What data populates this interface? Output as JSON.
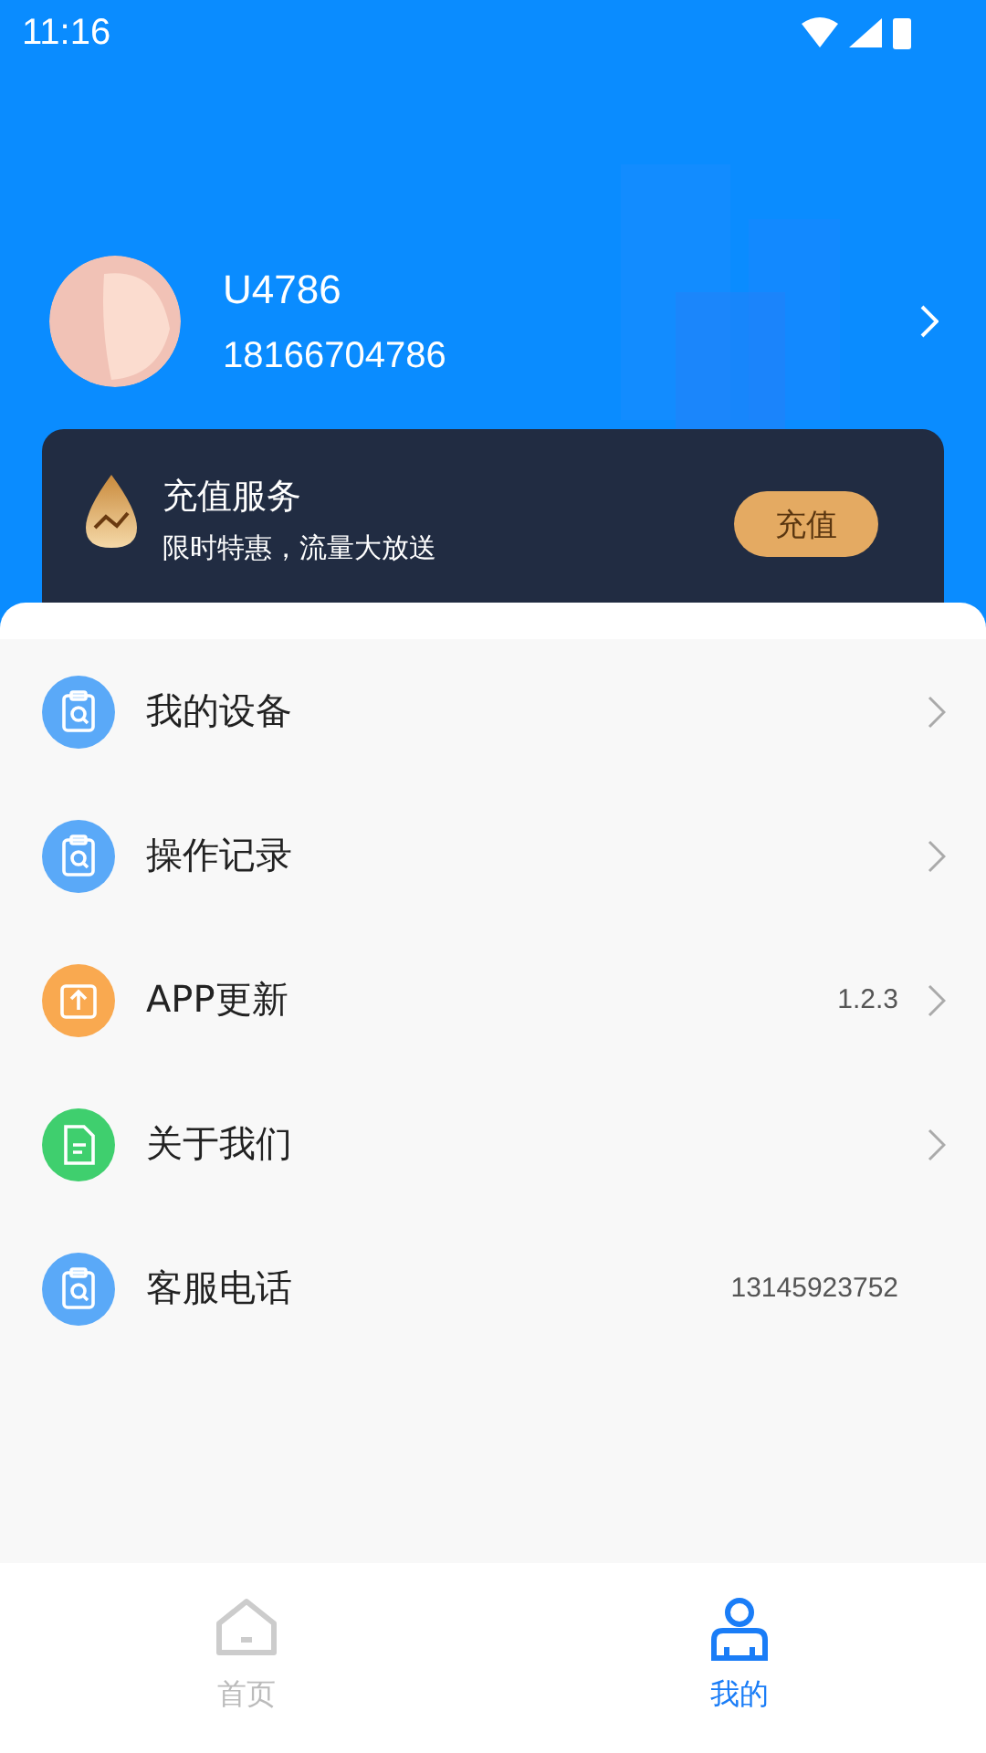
{
  "status_bar": {
    "time": "11:16"
  },
  "profile": {
    "username": "U4786",
    "phone": "18166704786"
  },
  "recharge_card": {
    "title": "充值服务",
    "subtitle": "限时特惠，流量大放送",
    "button": "充值"
  },
  "menu": [
    {
      "label": "我的设备",
      "color": "#5aa9f8",
      "kind": "device",
      "chevron": true
    },
    {
      "label": "操作记录",
      "color": "#5aa9f8",
      "kind": "device",
      "chevron": true
    },
    {
      "label": "APP更新",
      "color": "#f9a950",
      "kind": "update",
      "value": "1.2.3",
      "chevron": true
    },
    {
      "label": "关于我们",
      "color": "#3fcf6e",
      "kind": "doc",
      "chevron": true
    },
    {
      "label": "客服电话",
      "color": "#5aa9f8",
      "kind": "device",
      "value": "13145923752",
      "chevron": false
    }
  ],
  "tabs": [
    {
      "label": "首页",
      "kind": "home",
      "selected": false
    },
    {
      "label": "我的",
      "kind": "user",
      "selected": true
    }
  ]
}
